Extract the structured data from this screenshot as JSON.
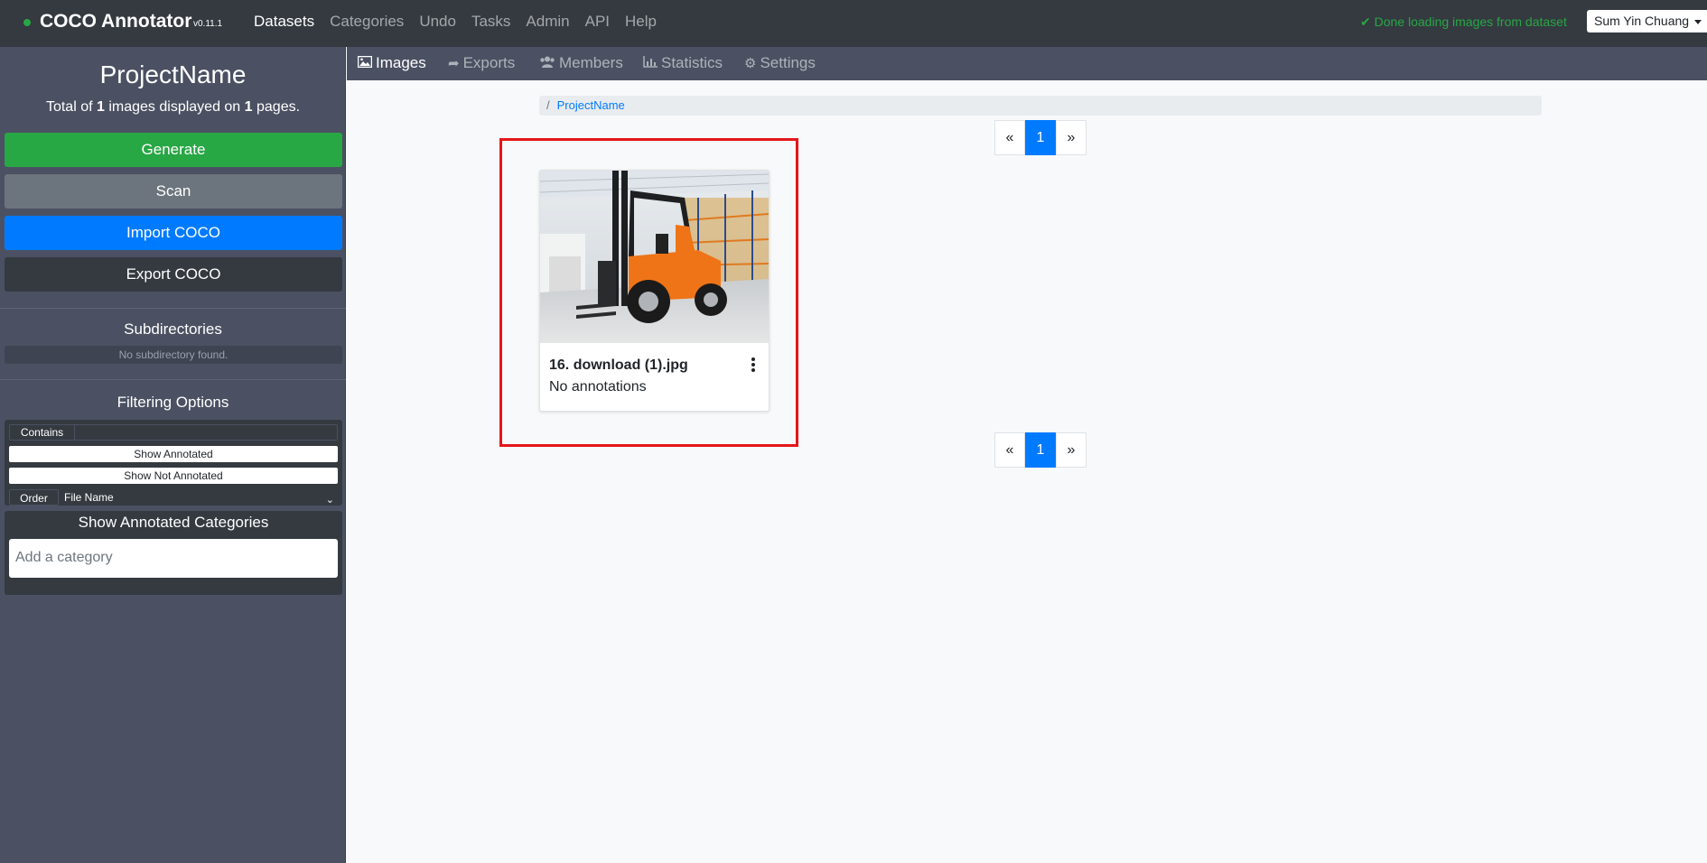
{
  "navbar": {
    "brand": "COCO Annotator",
    "version": "v0.11.1",
    "links": [
      {
        "label": "Datasets",
        "active": true
      },
      {
        "label": "Categories",
        "active": false
      },
      {
        "label": "Undo",
        "active": false
      },
      {
        "label": "Tasks",
        "active": false
      },
      {
        "label": "Admin",
        "active": false
      },
      {
        "label": "API",
        "active": false
      },
      {
        "label": "Help",
        "active": false
      }
    ],
    "status_icon": "check-icon",
    "status_text": "Done loading images from dataset",
    "user": "Sum Yin Chuang"
  },
  "sidebar": {
    "title": "ProjectName",
    "summary_prefix": "Total of ",
    "image_count": "1",
    "summary_middle": " images displayed on ",
    "page_count": "1",
    "summary_suffix": " pages.",
    "buttons": {
      "generate": "Generate",
      "scan": "Scan",
      "import": "Import COCO",
      "export": "Export COCO"
    },
    "subdirectories_heading": "Subdirectories",
    "subdirectories_empty": "No subdirectory found.",
    "filtering_heading": "Filtering Options",
    "contains_label": "Contains",
    "contains_value": "",
    "show_annotated": "Show Annotated",
    "show_not_annotated": "Show Not Annotated",
    "order_label": "Order",
    "order_value": "File Name",
    "categories_heading": "Show Annotated Categories",
    "category_placeholder": "Add a category"
  },
  "tabs": [
    {
      "label": "Images",
      "icon": "image-icon",
      "active": true
    },
    {
      "label": "Exports",
      "icon": "share-icon",
      "active": false
    },
    {
      "label": "Members",
      "icon": "users-icon",
      "active": false
    },
    {
      "label": "Statistics",
      "icon": "bar-chart-icon",
      "active": false
    },
    {
      "label": "Settings",
      "icon": "gear-icon",
      "active": false
    }
  ],
  "breadcrumb": {
    "separator": "/",
    "current": "ProjectName"
  },
  "pagination": {
    "prev": "«",
    "current_page": "1",
    "next": "»"
  },
  "image_card": {
    "title": "16. download (1).jpg",
    "annotation_status": "No annotations",
    "thumbnail": "orange forklift in warehouse"
  },
  "colors": {
    "navbar": "#343a40",
    "sidebar": "#4b5162",
    "success": "#28a745",
    "primary": "#007bff",
    "secondary": "#6c757d",
    "highlight": "#e4161b"
  }
}
